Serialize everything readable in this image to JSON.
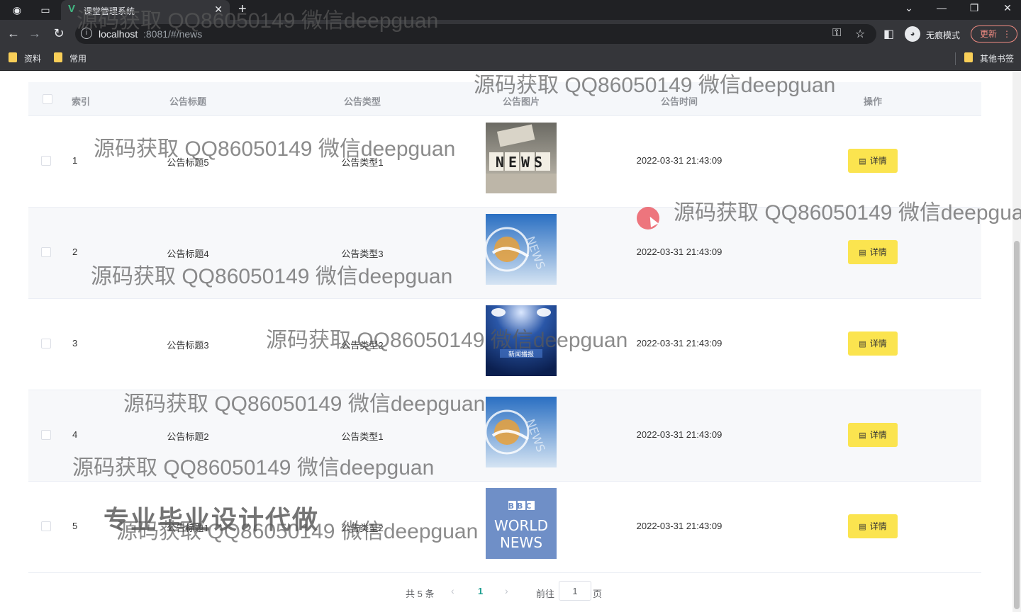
{
  "browser": {
    "tab_title": "课堂管理系统",
    "url_host": "localhost",
    "url_rest": ":8081/#/news",
    "incognito_label": "无痕模式",
    "update_label": "更新",
    "bookmarks": [
      "资料",
      "常用"
    ],
    "other_bookmarks": "其他书签"
  },
  "table": {
    "headers": {
      "index": "索引",
      "title": "公告标题",
      "type": "公告类型",
      "image": "公告图片",
      "time": "公告时间",
      "actions": "操作"
    },
    "rows": [
      {
        "index": "1",
        "title": "公告标题5",
        "type": "公告类型1",
        "image": "news-blocks",
        "time": "2022-03-31 21:43:09",
        "action": "详情"
      },
      {
        "index": "2",
        "title": "公告标题4",
        "type": "公告类型3",
        "image": "news-globe",
        "time": "2022-03-31 21:43:09",
        "action": "详情"
      },
      {
        "index": "3",
        "title": "公告标题3",
        "type": "公告类型2",
        "image": "news-broadcast",
        "time": "2022-03-31 21:43:09",
        "action": "详情"
      },
      {
        "index": "4",
        "title": "公告标题2",
        "type": "公告类型1",
        "image": "news-globe",
        "time": "2022-03-31 21:43:09",
        "action": "详情"
      },
      {
        "index": "5",
        "title": "公告标题1",
        "type": "公告类型2",
        "image": "bbc-world-news",
        "time": "2022-03-31 21:43:09",
        "action": "详情"
      }
    ]
  },
  "images": {
    "news_blocks_text": "NEWS",
    "bbc_top": "BBC",
    "bbc_mid": "WORLD",
    "bbc_bottom": "NEWS",
    "broadcast_caption": "新闻播报"
  },
  "pagination": {
    "total": "共 5 条",
    "current_page": "1",
    "goto_label": "前往",
    "goto_value": "1",
    "page_suffix": "页"
  },
  "watermark": {
    "text": "源码获取 QQ86050149 微信deepguan",
    "banner": "专业毕业设计代做"
  },
  "colors": {
    "detail_button": "#fbe44f",
    "active_page": "#1b9e8f",
    "header_bg": "#f5f7fa"
  }
}
